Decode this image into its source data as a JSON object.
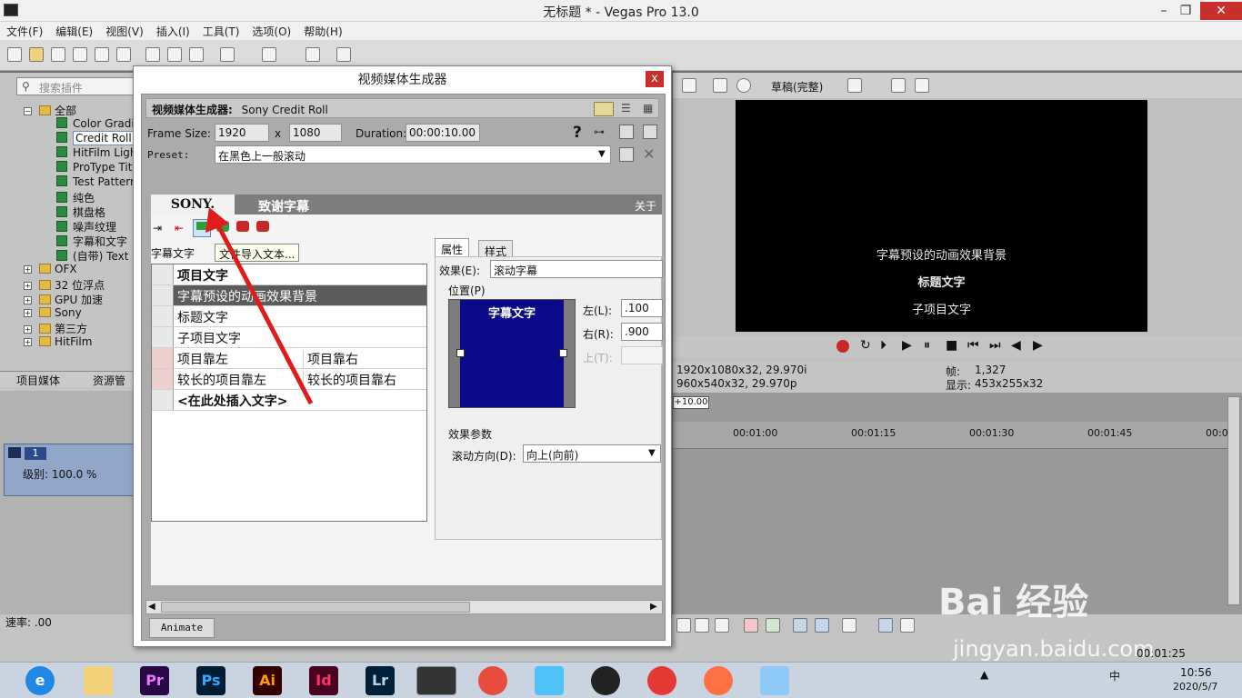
{
  "window": {
    "title": "无标题 * - Vegas Pro 13.0",
    "minimize": "–",
    "restore": "❐",
    "close": "✕"
  },
  "menu": [
    "文件(F)",
    "编辑(E)",
    "视图(V)",
    "插入(I)",
    "工具(T)",
    "选项(O)",
    "帮助(H)"
  ],
  "plugins_panel": {
    "search_placeholder": "搜索插件",
    "root": "全部",
    "items": [
      "Color Gradie",
      "Credit Roll",
      "HitFilm Ligh",
      "ProType Tit",
      "Test Pattern",
      "纯色",
      "棋盘格",
      "噪声纹理",
      "字幕和文字",
      "(自带) Text"
    ],
    "folders": [
      "OFX",
      "32 位浮点",
      "GPU 加速",
      "Sony",
      "第三方",
      "HitFilm"
    ],
    "tabs": [
      "项目媒体",
      "资源管理"
    ]
  },
  "track": {
    "number": "1",
    "level": "级别: 100.0 %",
    "rate": "速率: .00"
  },
  "preview": {
    "quality": "草稿(完整)",
    "lines": [
      "字幕预设的动画效果背景",
      "标题文字",
      "子项目文字"
    ],
    "project_info": "1920x1080x32, 29.970i",
    "preview_info": "960x540x32, 29.970p",
    "frame_label": "帧:",
    "frame_value": "1,327",
    "display_label": "显示:",
    "display_value": "453x255x32"
  },
  "timeline": {
    "marker": "+10.00",
    "ticks": [
      "00:01:00",
      "00:01:15",
      "00:01:30",
      "00:01:45",
      "00:0"
    ],
    "time_bottom": "00:01:25"
  },
  "dialog": {
    "title": "视频媒体生成器",
    "close": "x",
    "generator_label": "视频媒体生成器:",
    "generator_name": "Sony Credit Roll",
    "frame_size_label": "Frame Size:",
    "width": "1920",
    "x": "x",
    "height": "1080",
    "duration_label": "Duration:",
    "duration": "00:00:10.00",
    "help": "?",
    "preset_label": "Preset:",
    "preset": "在黑色上一般滚动",
    "sony_logo": "SONY.",
    "plugin_title": "致谢字幕",
    "about": "关于",
    "subtitle_label": "字幕文字",
    "tooltip": "文件导入文本...",
    "grid_header": "项目文字",
    "rows": [
      {
        "c1": "字幕预设的动画效果背景",
        "c2": ""
      },
      {
        "c1": "标题文字",
        "c2": ""
      },
      {
        "c1": "子项目文字",
        "c2": ""
      },
      {
        "c1": "项目靠左",
        "c2": "项目靠右"
      },
      {
        "c1": "较长的项目靠左",
        "c2": "较长的项目靠右"
      },
      {
        "c1": "<在此处插入文字>",
        "c2": ""
      }
    ],
    "tabs": [
      "属性",
      "样式"
    ],
    "effect_label": "效果(E):",
    "effect_value": "滚动字幕",
    "position_label": "位置(P)",
    "preview_text": "字幕文字",
    "left_label": "左(L):",
    "left_value": ".100",
    "right_label": "右(R):",
    "right_value": ".900",
    "top_label": "上(T):",
    "params_label": "效果参数",
    "scroll_label": "滚动方向(D):",
    "scroll_value": "向上(向前)",
    "animate": "Animate"
  },
  "taskbar": {
    "apps": [
      "Pr",
      "Ps",
      "Ai",
      "Id",
      "Lr"
    ],
    "time": "10:56",
    "date": "2020/5/7",
    "ime": "中"
  },
  "watermark": {
    "brand": "Bai 经验",
    "url": "jingyan.baidu.com"
  },
  "colors": {
    "preview_blue": "#0b0b8a",
    "arrow_red": "#e01b1b",
    "selection_dark": "#5c5c5c"
  }
}
